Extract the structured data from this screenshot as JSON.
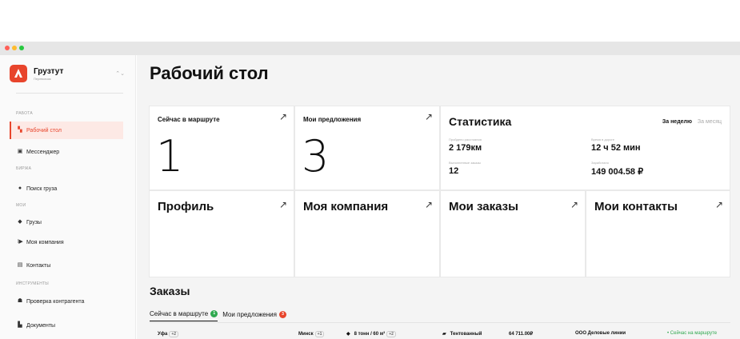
{
  "sidebar": {
    "brand_name": "Грузтут",
    "brand_sub": "Перевозчик",
    "sections": [
      "РАБОТА",
      "БИРЖА",
      "МОИ",
      "ИНСТРУМЕНТЫ"
    ],
    "items": [
      {
        "label": "Рабочий стол",
        "icon": "grid-icon"
      },
      {
        "label": "Мессенджер",
        "icon": "chat-icon"
      },
      {
        "label": "Поиск груза",
        "icon": "globe-icon"
      },
      {
        "label": "Грузы",
        "icon": "box-icon"
      },
      {
        "label": "Моя компания",
        "icon": "truck-icon"
      },
      {
        "label": "Контакты",
        "icon": "contacts-icon"
      },
      {
        "label": "Проверка контрагента",
        "icon": "person-check-icon"
      },
      {
        "label": "Документы",
        "icon": "document-icon"
      }
    ]
  },
  "main": {
    "title": "Рабочий стол",
    "cards": {
      "in_route": {
        "title": "Сейчас в маршруте",
        "value": "1"
      },
      "offers": {
        "title": "Мои предложения",
        "value": "3"
      },
      "profile": {
        "title": "Профиль"
      },
      "company": {
        "title": "Моя компания"
      },
      "orders": {
        "title": "Мои заказы"
      },
      "contacts": {
        "title": "Мои контакты"
      }
    },
    "stats": {
      "title": "Статистика",
      "period_week": "За неделю",
      "period_month": "За месяц",
      "distance_label": "Пройдено расстояния",
      "distance_value": "2 179км",
      "time_label": "Время в дороге",
      "time_value": "12 ч 52 мин",
      "completed_label": "Выполненные заказы",
      "completed_value": "12",
      "earned_label": "Заработано",
      "earned_value": "149 004.58 ₽"
    },
    "orders_section": {
      "title": "Заказы",
      "tabs": [
        {
          "label": "Сейчас в маршруте",
          "count": "1"
        },
        {
          "label": "Мои предложения",
          "count": "3"
        }
      ],
      "rows": [
        {
          "from": "Уфа",
          "from_extra": "+2",
          "to": "Минск",
          "to_extra": "+1",
          "cargo": "8 тонн / 60 м³",
          "cargo_extra": "+2",
          "body": "Тентованный",
          "price": "64 711.00₽",
          "company": "ООО Деловые линии",
          "status": "• Сейчас на маршруте"
        }
      ]
    }
  },
  "colors": {
    "accent": "#e8452c",
    "success": "#2fa84f"
  }
}
